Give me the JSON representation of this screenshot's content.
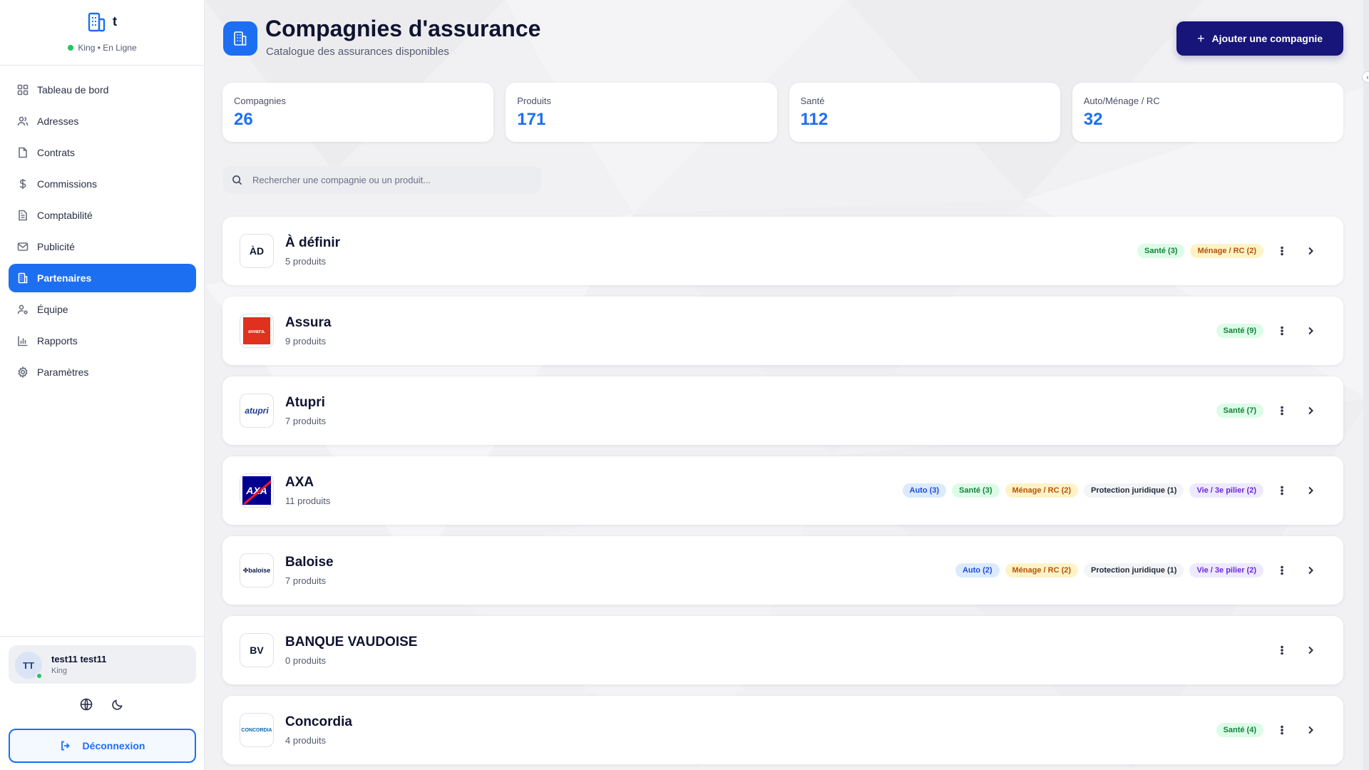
{
  "sidebar": {
    "brand_letter": "t",
    "status_text": "King • En Ligne",
    "items": [
      {
        "label": "Tableau de bord",
        "icon": "grid-icon"
      },
      {
        "label": "Adresses",
        "icon": "users-icon"
      },
      {
        "label": "Contrats",
        "icon": "file-icon"
      },
      {
        "label": "Commissions",
        "icon": "dollar-icon"
      },
      {
        "label": "Comptabilité",
        "icon": "file-text-icon"
      },
      {
        "label": "Publicité",
        "icon": "mail-icon"
      },
      {
        "label": "Partenaires",
        "icon": "building-icon",
        "active": true
      },
      {
        "label": "Équipe",
        "icon": "user-cog-icon"
      },
      {
        "label": "Rapports",
        "icon": "bar-chart-icon"
      },
      {
        "label": "Paramètres",
        "icon": "gear-icon"
      }
    ],
    "user": {
      "initials": "TT",
      "name": "test11 test11",
      "role": "King"
    },
    "logout_label": "Déconnexion"
  },
  "header": {
    "title": "Compagnies d'assurance",
    "subtitle": "Catalogue des assurances disponibles",
    "add_button": "Ajouter une compagnie"
  },
  "stats": [
    {
      "label": "Compagnies",
      "value": "26"
    },
    {
      "label": "Produits",
      "value": "171"
    },
    {
      "label": "Santé",
      "value": "112"
    },
    {
      "label": "Auto/Ménage / RC",
      "value": "32"
    }
  ],
  "search": {
    "placeholder": "Rechercher une compagnie ou un produit..."
  },
  "companies": [
    {
      "name": "À définir",
      "count": "5 produits",
      "logo_text": "ÀD",
      "tags": [
        {
          "label": "Santé (3)",
          "kind": "sante"
        },
        {
          "label": "Ménage / RC (2)",
          "kind": "menage"
        }
      ]
    },
    {
      "name": "Assura",
      "count": "9 produits",
      "logo_text": "assura.",
      "tags": [
        {
          "label": "Santé (9)",
          "kind": "sante"
        }
      ]
    },
    {
      "name": "Atupri",
      "count": "7 produits",
      "logo_text": "atupri",
      "tags": [
        {
          "label": "Santé (7)",
          "kind": "sante"
        }
      ]
    },
    {
      "name": "AXA",
      "count": "11 produits",
      "logo_text": "AXA",
      "tags": [
        {
          "label": "Auto (3)",
          "kind": "auto"
        },
        {
          "label": "Santé (3)",
          "kind": "sante"
        },
        {
          "label": "Ménage / RC (2)",
          "kind": "menage"
        },
        {
          "label": "Protection juridique (1)",
          "kind": "pj"
        },
        {
          "label": "Vie / 3e pilier (2)",
          "kind": "vie"
        }
      ]
    },
    {
      "name": "Baloise",
      "count": "7 produits",
      "logo_text": "✤baloise",
      "tags": [
        {
          "label": "Auto (2)",
          "kind": "auto"
        },
        {
          "label": "Ménage / RC (2)",
          "kind": "menage"
        },
        {
          "label": "Protection juridique (1)",
          "kind": "pj"
        },
        {
          "label": "Vie / 3e pilier (2)",
          "kind": "vie"
        }
      ]
    },
    {
      "name": "BANQUE VAUDOISE",
      "count": "0 produits",
      "logo_text": "BV",
      "tags": []
    },
    {
      "name": "Concordia",
      "count": "4 produits",
      "logo_text": "CONCORDIA",
      "tags": [
        {
          "label": "Santé (4)",
          "kind": "sante"
        }
      ]
    }
  ],
  "colors": {
    "accent": "#1d6ff2",
    "primary_button": "#17147a"
  }
}
